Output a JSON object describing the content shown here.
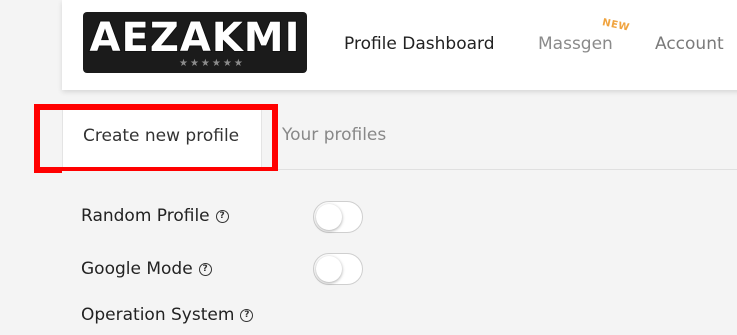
{
  "navbar": {
    "logo_text": "AEZAKMI",
    "logo_stars": "★★★★★★",
    "items": [
      {
        "label": "Profile Dashboard"
      },
      {
        "label": "Massgen",
        "badge": "NEW"
      },
      {
        "label": "Account"
      }
    ]
  },
  "tabs": [
    {
      "label": "Create new profile",
      "active": true
    },
    {
      "label": "Your profiles",
      "active": false
    }
  ],
  "form": {
    "rows": [
      {
        "label": "Random Profile",
        "help": "?",
        "toggle_on": false
      },
      {
        "label": "Google Mode",
        "help": "?",
        "toggle_on": false
      },
      {
        "label": "Operation System",
        "help": "?"
      }
    ]
  },
  "colors": {
    "highlight": "#ff0000",
    "new_badge": "#f0a33e"
  }
}
